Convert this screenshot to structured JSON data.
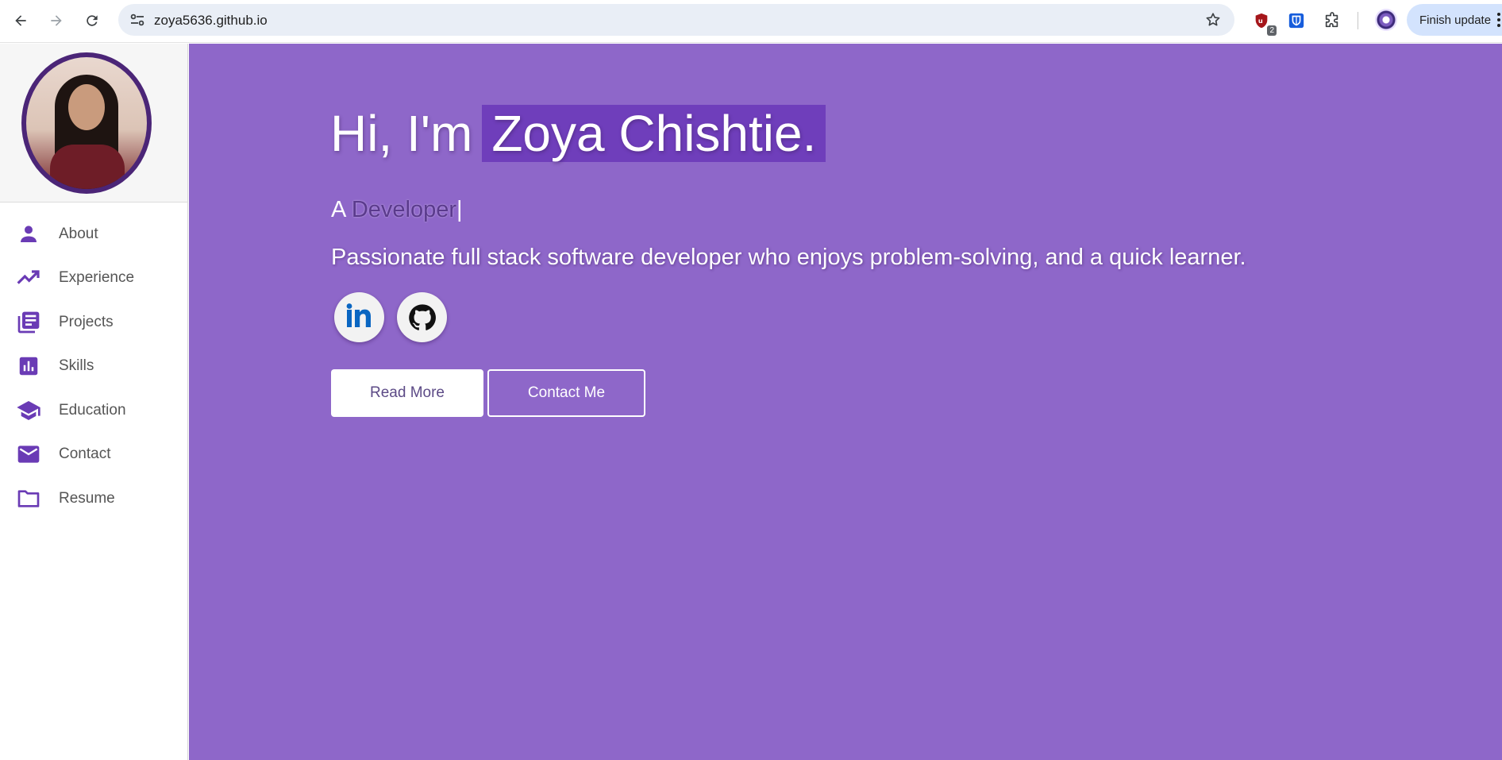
{
  "browser": {
    "url": "zoya5636.github.io",
    "extension_badge": "2",
    "finish_update_label": "Finish update"
  },
  "sidebar": {
    "items": [
      {
        "label": "About",
        "icon": "person-icon"
      },
      {
        "label": "Experience",
        "icon": "trending-up-icon"
      },
      {
        "label": "Projects",
        "icon": "library-books-icon"
      },
      {
        "label": "Skills",
        "icon": "bar-chart-icon"
      },
      {
        "label": "Education",
        "icon": "school-icon"
      },
      {
        "label": "Contact",
        "icon": "mail-icon"
      },
      {
        "label": "Resume",
        "icon": "folder-icon"
      }
    ]
  },
  "hero": {
    "greeting": "Hi, I'm",
    "name": "Zoya Chishtie.",
    "typed_prefix": "A",
    "typed_word": "Developer",
    "typed_cursor": "|",
    "description": "Passionate full stack software developer who enjoys problem-solving, and a quick learner.",
    "social": [
      {
        "name": "linkedin",
        "icon": "linkedin-icon"
      },
      {
        "name": "github",
        "icon": "github-icon"
      }
    ],
    "read_more_label": "Read More",
    "contact_me_label": "Contact Me"
  },
  "colors": {
    "hero_bg": "#8e67c9",
    "name_highlight": "#6f3ebb",
    "accent": "#6a3bb5",
    "avatar_border": "#4b2577"
  }
}
